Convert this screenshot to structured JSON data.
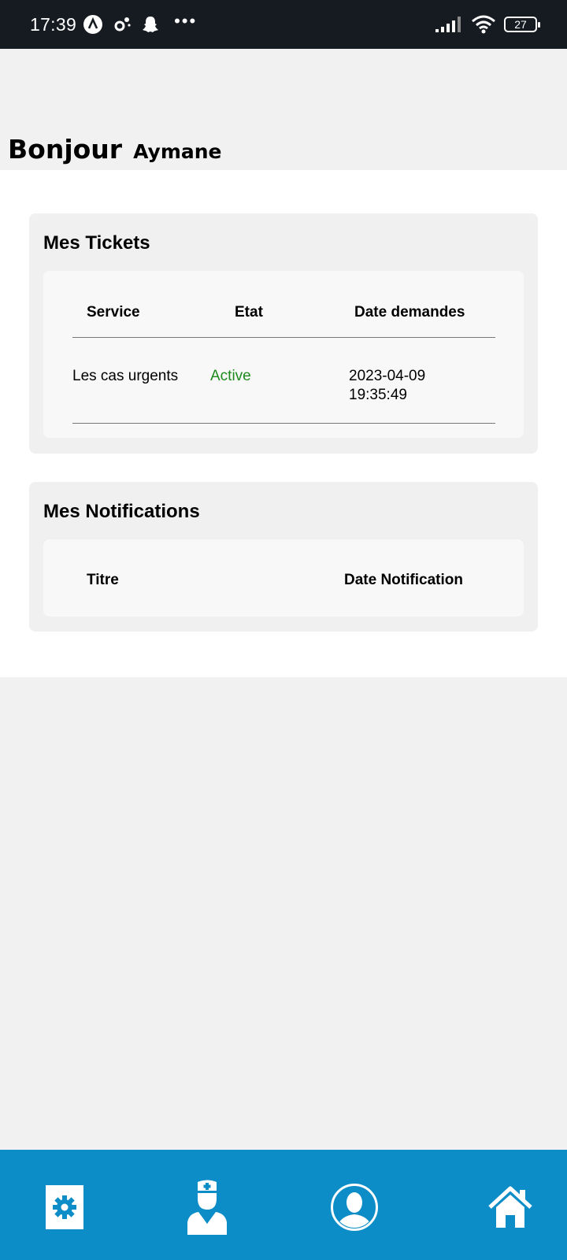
{
  "status_bar": {
    "time": "17:39",
    "battery": "27",
    "dots": "•••",
    "icons": [
      "app-a-icon",
      "settings-dots-icon",
      "snapchat-icon",
      "signal-icon",
      "wifi-icon",
      "battery-icon"
    ]
  },
  "greeting": {
    "word": "Bonjour",
    "name": "Aymane"
  },
  "tickets": {
    "title": "Mes Tickets",
    "columns": [
      "Service",
      "Etat",
      "Date demandes"
    ],
    "rows": [
      {
        "service": "Les cas urgents",
        "etat": "Active",
        "date": "2023-04-09",
        "time": "19:35:49"
      }
    ]
  },
  "notifications": {
    "title": "Mes Notifications",
    "columns": [
      "Titre",
      "Date Notification"
    ]
  },
  "bottom_nav": {
    "items": [
      "settings-icon",
      "doctor-icon",
      "profile-icon",
      "home-icon"
    ]
  },
  "colors": {
    "status_bar_bg": "#161b22",
    "accent": "#0c8dc7",
    "active_status": "#1e8a1e",
    "page_bg": "#f1f1f1",
    "card_bg": "#f0f0f0"
  }
}
